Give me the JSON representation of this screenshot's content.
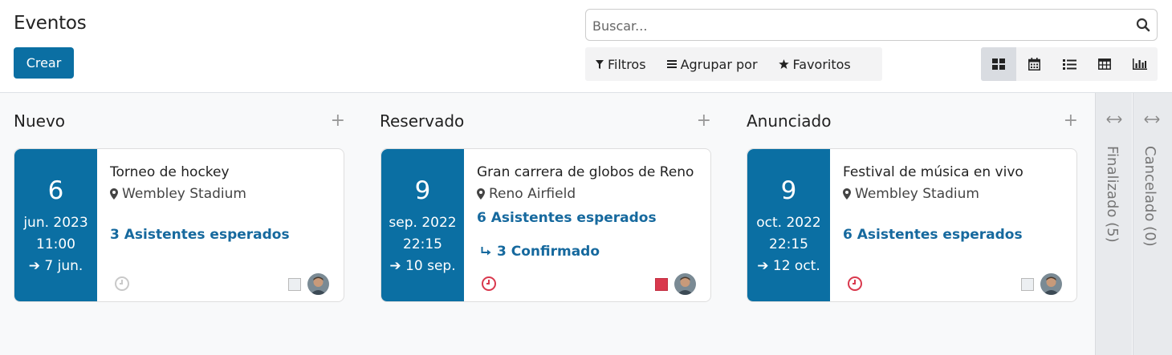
{
  "header": {
    "title": "Eventos",
    "create_label": "Crear"
  },
  "search": {
    "placeholder": "Buscar...",
    "value": ""
  },
  "filters": {
    "filters_label": "Filtros",
    "group_by_label": "Agrupar por",
    "favorites_label": "Favoritos"
  },
  "views": [
    "kanban",
    "calendar",
    "list",
    "pivot",
    "graph"
  ],
  "columns": [
    {
      "title": "Nuevo",
      "card": {
        "day": "6",
        "month_year": "jun. 2023",
        "time": "11:00",
        "end": "7 jun.",
        "name": "Torneo de hockey",
        "location": "Wembley Stadium",
        "attendees": "3 Asistentes esperados",
        "confirmed": "",
        "clock_color": "#c9c9c9",
        "status": "grey"
      }
    },
    {
      "title": "Reservado",
      "card": {
        "day": "9",
        "month_year": "sep. 2022",
        "time": "22:15",
        "end": "10 sep.",
        "name": "Gran carrera de globos de Reno",
        "location": "Reno Airfield",
        "attendees": "6 Asistentes esperados",
        "confirmed": "3 Confirmado",
        "clock_color": "#d9384d",
        "status": "red"
      }
    },
    {
      "title": "Anunciado",
      "card": {
        "day": "9",
        "month_year": "oct. 2022",
        "time": "22:15",
        "end": "12 oct.",
        "name": "Festival de música en vivo",
        "location": "Wembley Stadium",
        "attendees": "6 Asistentes esperados",
        "confirmed": "",
        "clock_color": "#d9384d",
        "status": "grey"
      }
    }
  ],
  "folded_columns": [
    {
      "label": "Finalizado (5)"
    },
    {
      "label": "Cancelado (0)"
    }
  ],
  "colors": {
    "primary": "#0b6fa3",
    "link": "#16699e",
    "danger": "#d9384d"
  }
}
